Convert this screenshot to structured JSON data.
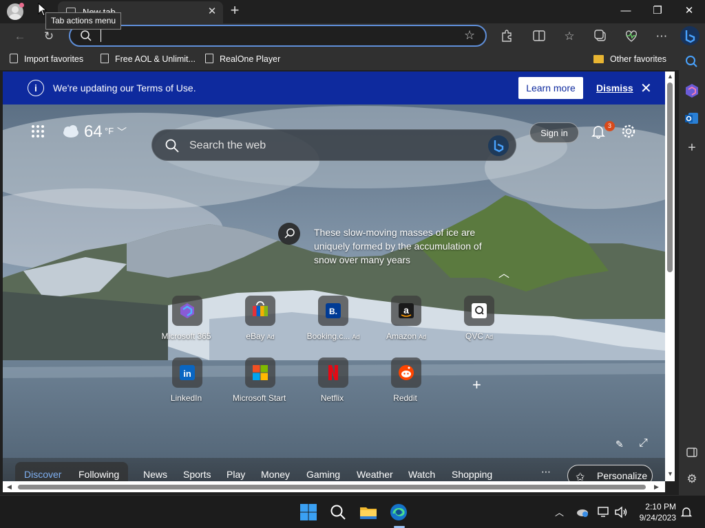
{
  "browser": {
    "tab_title": "New tab",
    "tooltip": "Tab actions menu",
    "address_value": "",
    "favorites": [
      "Import favorites",
      "Free AOL & Unlimit...",
      "RealOne Player"
    ],
    "other_favorites": "Other favorites"
  },
  "banner": {
    "message": "We're updating our Terms of Use.",
    "learn_more": "Learn more",
    "dismiss": "Dismiss"
  },
  "weather": {
    "temp": "64",
    "unit": "°F"
  },
  "search": {
    "placeholder": "Search the web"
  },
  "header": {
    "sign_in": "Sign in",
    "notifications": "3"
  },
  "image_caption": "These slow-moving masses of ice are uniquely formed by the accumulation of snow over many years",
  "tiles": [
    {
      "label": "Microsoft 365",
      "ad": ""
    },
    {
      "label": "eBay",
      "ad": "Ad"
    },
    {
      "label": "Booking.c...",
      "ad": "Ad"
    },
    {
      "label": "Amazon",
      "ad": "Ad"
    },
    {
      "label": "QVC",
      "ad": "Ad"
    },
    {
      "label": "LinkedIn",
      "ad": ""
    },
    {
      "label": "Microsoft Start",
      "ad": ""
    },
    {
      "label": "Netflix",
      "ad": ""
    },
    {
      "label": "Reddit",
      "ad": ""
    }
  ],
  "feed_nav": [
    "Discover",
    "Following",
    "News",
    "Sports",
    "Play",
    "Money",
    "Gaming",
    "Weather",
    "Watch",
    "Shopping"
  ],
  "personalize": "Personalize",
  "taskbar": {
    "time": "2:10 PM",
    "date": "9/24/2023"
  }
}
